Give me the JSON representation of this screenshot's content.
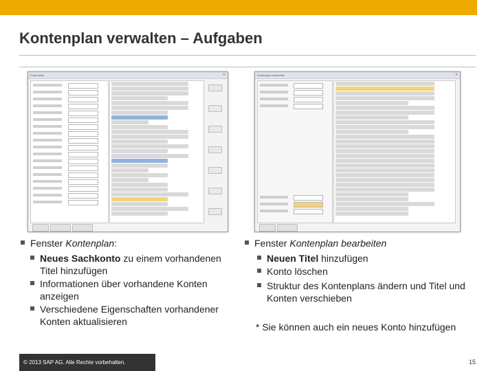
{
  "header": {
    "title": "Kontenplan verwalten – Aufgaben"
  },
  "left": {
    "heading_prefix": "Fenster ",
    "heading_italic": "Kontenplan",
    "heading_suffix": ":",
    "items": [
      {
        "bold": "Neues Sachkonto",
        "text": " zu einem vorhandenen Titel hinzufügen"
      },
      {
        "bold": "",
        "text": "Informationen über vorhandene Konten anzeigen"
      },
      {
        "bold": "",
        "text": "Verschiedene Eigenschaften vorhandener Konten aktualisieren"
      }
    ]
  },
  "right": {
    "heading_prefix": "Fenster ",
    "heading_italic": "Kontenplan bearbeiten",
    "items": [
      {
        "bold": "Neuen Titel",
        "text": " hinzufügen"
      },
      {
        "bold": "",
        "text": "Konto löschen"
      },
      {
        "bold": "",
        "text": "Struktur des Kontenplans ändern und Titel und Konten verschieben"
      }
    ],
    "note": "*  Sie können auch ein neues Konto hinzufügen"
  },
  "screenshot_left": {
    "window_title": "Kontenplan"
  },
  "screenshot_right": {
    "window_title": "Kontenplan bearbeiten"
  },
  "footer": {
    "copyright": "© 2013 SAP AG. Alle Rechte vorbehalten.",
    "page_number": "15"
  },
  "colors": {
    "accent": "#f0ab00",
    "footer_bg": "#333333"
  }
}
